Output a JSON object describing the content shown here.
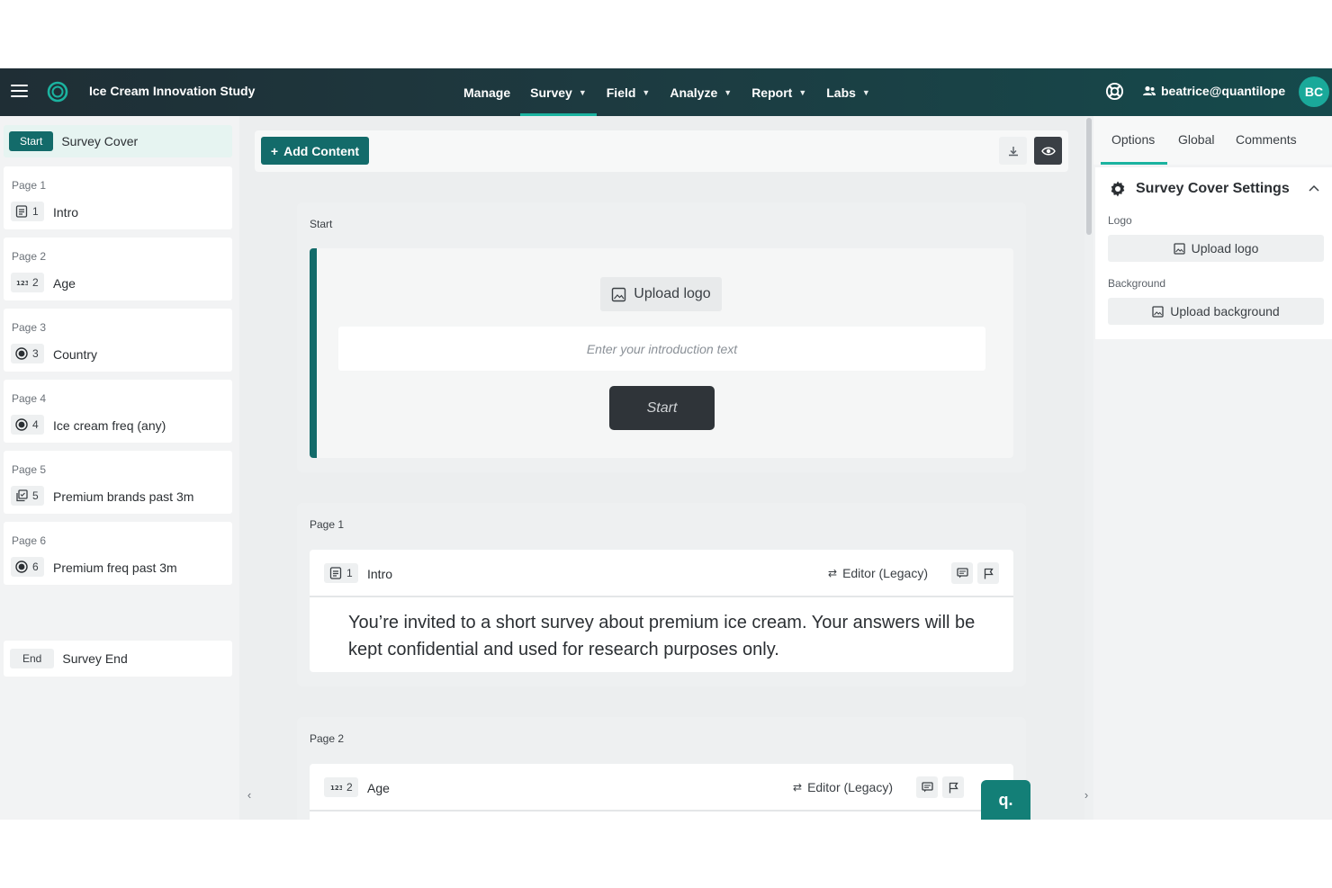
{
  "topbar": {
    "study_title": "Ice Cream Innovation Study",
    "nav": [
      {
        "label": "Manage",
        "has_dropdown": false
      },
      {
        "label": "Survey",
        "has_dropdown": true,
        "active": true
      },
      {
        "label": "Field",
        "has_dropdown": true
      },
      {
        "label": "Analyze",
        "has_dropdown": true
      },
      {
        "label": "Report",
        "has_dropdown": true
      },
      {
        "label": "Labs",
        "has_dropdown": true
      }
    ],
    "user_email": "beatrice@quantilope",
    "avatar_initials": "BC",
    "accent_color": "#1bb3a0"
  },
  "sidebar": {
    "cover_tag": "Start",
    "cover_label": "Survey Cover",
    "pages": [
      {
        "page": "Page 1",
        "num": "1",
        "title": "Intro",
        "icon": "text-block-icon"
      },
      {
        "page": "Page 2",
        "num": "2",
        "title": "Age",
        "icon": "numeric-icon"
      },
      {
        "page": "Page 3",
        "num": "3",
        "title": "Country",
        "icon": "radio-icon"
      },
      {
        "page": "Page 4",
        "num": "4",
        "title": "Ice cream freq (any)",
        "icon": "radio-icon"
      },
      {
        "page": "Page 5",
        "num": "5",
        "title": "Premium brands past 3m",
        "icon": "multi-select-icon"
      },
      {
        "page": "Page 6",
        "num": "6",
        "title": "Premium freq past 3m",
        "icon": "radio-icon"
      }
    ],
    "end_tag": "End",
    "end_label": "Survey End"
  },
  "toolbar": {
    "add_content_label": "Add Content"
  },
  "editor": {
    "start_section_label": "Start",
    "upload_logo_label": "Upload logo",
    "intro_placeholder": "Enter your introduction text",
    "start_button_label": "Start",
    "page1_label": "Page 1",
    "page1_question": {
      "num": "1",
      "title": "Intro",
      "editor_label": "Editor (Legacy)",
      "body": "You’re invited to a short survey about premium ice cream. Your answers will be kept confidential and used for research purposes only."
    },
    "page2_label": "Page 2",
    "page2_question": {
      "num": "2",
      "title": "Age",
      "editor_label": "Editor (Legacy)"
    }
  },
  "fab_label": "q.",
  "right_panel": {
    "tabs": [
      "Options",
      "Global",
      "Comments"
    ],
    "active_tab": "Options",
    "settings_title": "Survey Cover Settings",
    "logo_label": "Logo",
    "upload_logo_label": "Upload logo",
    "background_label": "Background",
    "upload_background_label": "Upload background"
  }
}
